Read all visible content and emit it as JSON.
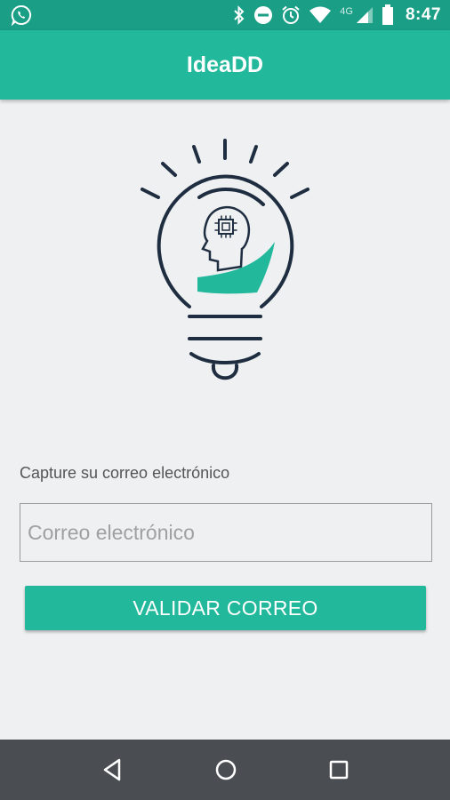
{
  "status_bar": {
    "network": "4G",
    "time": "8:47",
    "icons": [
      "whatsapp-icon",
      "bluetooth-icon",
      "do-not-disturb-icon",
      "alarm-icon",
      "wifi-icon",
      "signal-icon",
      "battery-icon"
    ]
  },
  "app_bar": {
    "title": "IdeaDD"
  },
  "form": {
    "label": "Capture su correo electrónico",
    "email_placeholder": "Correo electrónico",
    "email_value": "",
    "validate_label": "VALIDAR CORREO"
  },
  "nav_bar": {
    "icons": [
      "back-icon",
      "home-icon",
      "recents-icon"
    ]
  },
  "colors": {
    "primary": "#22b89b",
    "primary_dark": "#1a9e86",
    "background": "#eef0f2",
    "logo_navy": "#1f2d40",
    "nav_bar": "#4a4e52"
  }
}
